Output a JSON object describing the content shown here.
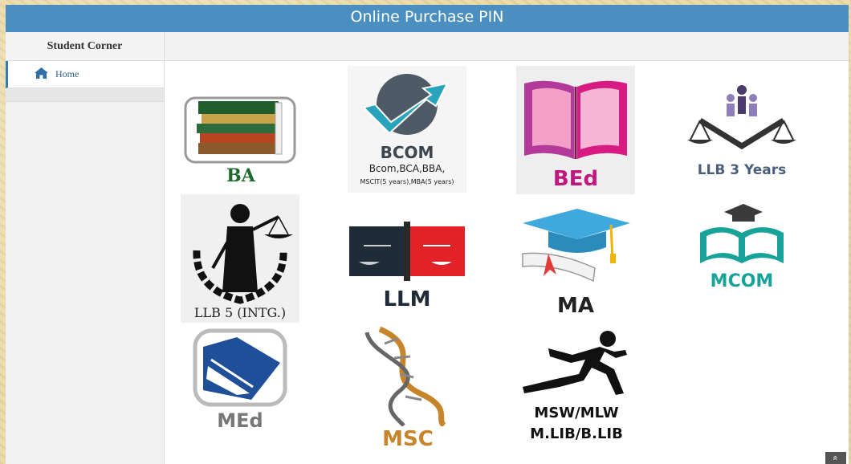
{
  "header": {
    "title": "Online Purchase PIN"
  },
  "sidebar": {
    "title": "Student Corner",
    "items": [
      {
        "label": "Home",
        "icon": "home-icon"
      }
    ]
  },
  "courses": {
    "ba": {
      "label": "BA"
    },
    "bcom": {
      "label": "BCOM",
      "line1": "Bcom,BCA,BBA,",
      "line2": "MSCIT(5 years),MBA(5 years)"
    },
    "bed": {
      "label": "BEd"
    },
    "llb3": {
      "label": "LLB 3 Years"
    },
    "llb5": {
      "label": "LLB 5 (INTG.)"
    },
    "llm": {
      "label": "LLM"
    },
    "ma": {
      "label": "MA"
    },
    "mcom": {
      "label": "MCOM"
    },
    "med": {
      "label": "MEd"
    },
    "msc": {
      "label": "MSC"
    },
    "msw": {
      "line1": "MSW/MLW",
      "line2": "M.LIB/B.LIB"
    }
  },
  "scroll_top": {
    "glyph": "»"
  },
  "colors": {
    "header_bg": "#4a8fc0",
    "ba_green": "#1d6a2d",
    "bcom_teal": "#2aa3bd",
    "bed_magenta": "#c0187e",
    "llb3_blue": "#4b5f7c",
    "llm_red": "#e32228",
    "ma_blue": "#3fa9dd",
    "mcom_teal": "#17a39a",
    "med_blue": "#1f4f99",
    "msc_orange": "#c8842a"
  }
}
